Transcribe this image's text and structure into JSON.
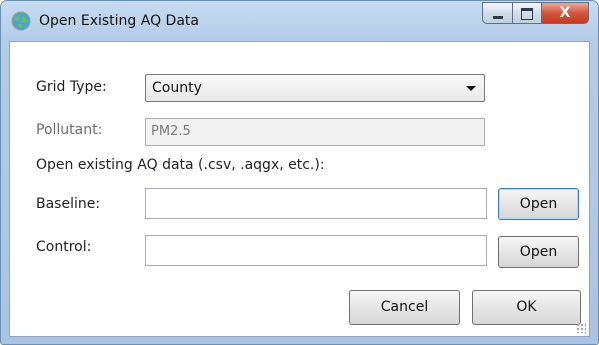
{
  "window": {
    "title": "Open Existing AQ Data",
    "close_glyph": "X",
    "icon": "globe-icon"
  },
  "form": {
    "grid_type": {
      "label": "Grid Type:",
      "value": "County"
    },
    "pollutant": {
      "label": "Pollutant:",
      "value": "PM2.5"
    },
    "instructions": "Open existing AQ data (.csv, .aqgx, etc.):",
    "baseline": {
      "label": "Baseline:",
      "value": "",
      "open_label": "Open"
    },
    "control": {
      "label": "Control:",
      "value": "",
      "open_label": "Open"
    }
  },
  "buttons": {
    "cancel": "Cancel",
    "ok": "OK"
  },
  "colors": {
    "frame": "#b3cce8",
    "close": "#d4553d",
    "focus": "#3c7fb1"
  }
}
